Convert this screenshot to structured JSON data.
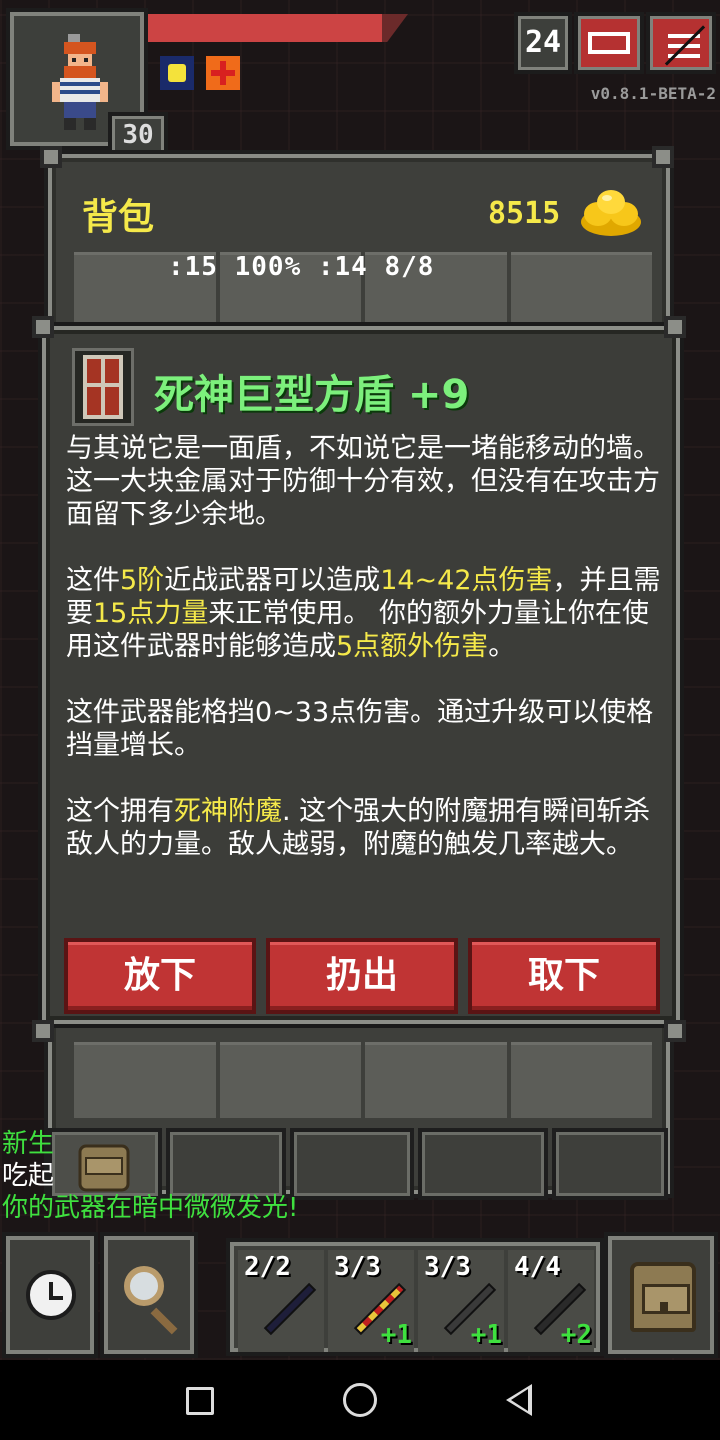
{
  "status": {
    "hero_level": "30",
    "hp_fraction": 0.9,
    "buffs": [
      "light-buff-icon",
      "heal-buff-icon"
    ],
    "dungeon_depth": "24",
    "version": "v0.8.1-BETA-2"
  },
  "inventory": {
    "title": "背包",
    "gold": "8515",
    "stats_line": ":15 100% :14 8/8"
  },
  "item": {
    "name": "死神巨型方盾 +9",
    "description_1": "与其说它是一面盾，不如说它是一堵能移动的墙。这一大块金属对于防御十分有效，但没有在攻击方面留下多少余地。",
    "desc2": {
      "a": "这件",
      "tier": "5阶",
      "b": "近战武器可以造成",
      "damage": "14~42点伤害",
      "c": "，并且需要",
      "strength": "15点力量",
      "d": "来正常使用。 你的额外力量让你在使用这件武器时能够造成",
      "bonus": "5点额外伤害",
      "e": "。"
    },
    "description_3": "这件武器能格挡0~33点伤害。通过升级可以使格挡量增长。",
    "desc4": {
      "a": "这个拥有",
      "enchant": "死神附魔",
      "b": ". 这个强大的附魔拥有瞬间斩杀敌人的力量。敌人越弱，附魔的触发几率越大。"
    },
    "actions": {
      "drop": "放下",
      "throw": "扔出",
      "unequip": "取下"
    }
  },
  "log": {
    "line1": "新生",
    "line2": "吃起",
    "line3": "你的武器在暗中微微发光!"
  },
  "quickslots": [
    {
      "count": "2/2",
      "bonus": ""
    },
    {
      "count": "3/3",
      "bonus": "+1"
    },
    {
      "count": "3/3",
      "bonus": "+1"
    },
    {
      "count": "4/4",
      "bonus": "+2"
    }
  ],
  "colors": {
    "item_name": "#7cf07c",
    "highlight": "#f5e94a",
    "button_red": "#c03434",
    "log_green": "#3fe03f"
  }
}
